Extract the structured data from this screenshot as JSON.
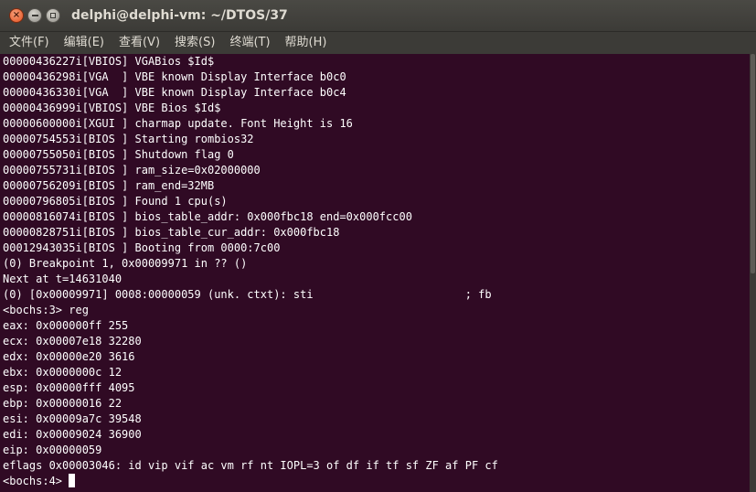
{
  "window": {
    "title": "delphi@delphi-vm: ~/DTOS/37",
    "buttons": {
      "close": "×",
      "minimize": "",
      "maximize": ""
    }
  },
  "menubar": {
    "items": [
      {
        "label": "文件(F)"
      },
      {
        "label": "编辑(E)"
      },
      {
        "label": "查看(V)"
      },
      {
        "label": "搜索(S)"
      },
      {
        "label": "终端(T)"
      },
      {
        "label": "帮助(H)"
      }
    ]
  },
  "terminal": {
    "lines": [
      "00000436227i[VBIOS] VGABios $Id$",
      "00000436298i[VGA  ] VBE known Display Interface b0c0",
      "00000436330i[VGA  ] VBE known Display Interface b0c4",
      "00000436999i[VBIOS] VBE Bios $Id$",
      "00000600000i[XGUI ] charmap update. Font Height is 16",
      "00000754553i[BIOS ] Starting rombios32",
      "00000755050i[BIOS ] Shutdown flag 0",
      "00000755731i[BIOS ] ram_size=0x02000000",
      "00000756209i[BIOS ] ram_end=32MB",
      "00000796805i[BIOS ] Found 1 cpu(s)",
      "00000816074i[BIOS ] bios_table_addr: 0x000fbc18 end=0x000fcc00",
      "00000828751i[BIOS ] bios_table_cur_addr: 0x000fbc18",
      "00012943035i[BIOS ] Booting from 0000:7c00",
      "(0) Breakpoint 1, 0x00009971 in ?? ()",
      "Next at t=14631040",
      "(0) [0x00009971] 0008:00000059 (unk. ctxt): sti                       ; fb",
      "<bochs:3> reg",
      "eax: 0x000000ff 255",
      "ecx: 0x00007e18 32280",
      "edx: 0x00000e20 3616",
      "ebx: 0x0000000c 12",
      "esp: 0x00000fff 4095",
      "ebp: 0x00000016 22",
      "esi: 0x00009a7c 39548",
      "edi: 0x00009024 36900",
      "eip: 0x00000059",
      "eflags 0x00003046: id vip vif ac vm rf nt IOPL=3 of df if tf sf ZF af PF cf",
      "<bochs:4> "
    ]
  },
  "colors": {
    "terminal_bg": "#300a24",
    "terminal_fg": "#ffffff",
    "chrome_bg": "#3c3b37",
    "close_button": "#e3501f"
  }
}
